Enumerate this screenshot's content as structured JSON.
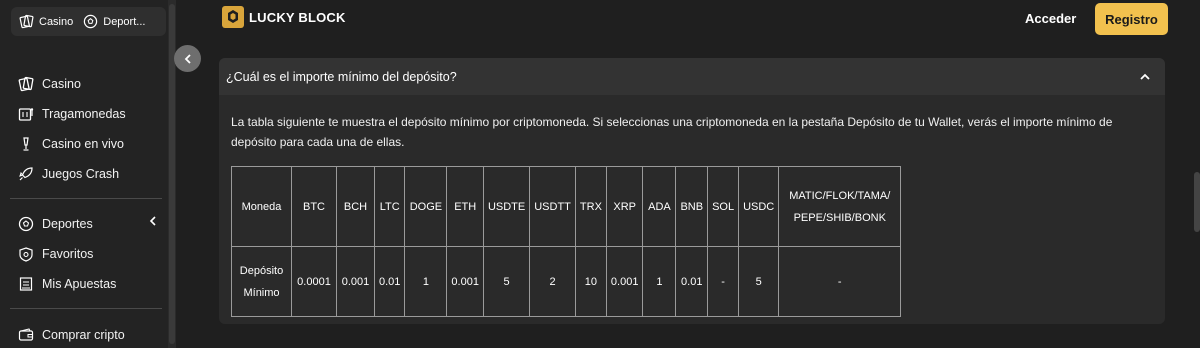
{
  "sidebar": {
    "top_tabs": [
      {
        "label": "Casino",
        "icon": "casino-icon"
      },
      {
        "label": "Deport...",
        "icon": "soccer-ball-icon"
      }
    ],
    "items": [
      {
        "label": "Casino",
        "icon": "casino-icon"
      },
      {
        "label": "Tragamonedas",
        "icon": "slot-machine-icon"
      },
      {
        "label": "Casino en vivo",
        "icon": "live-casino-icon"
      },
      {
        "label": "Juegos Crash",
        "icon": "rocket-icon"
      },
      {
        "label": "Deportes",
        "icon": "soccer-ball-icon"
      },
      {
        "label": "Favoritos",
        "icon": "favorites-icon"
      },
      {
        "label": "Mis Apuestas",
        "icon": "bets-icon"
      },
      {
        "label": "Comprar cripto",
        "icon": "wallet-icon"
      }
    ]
  },
  "header": {
    "logo_text": "LUCKY BLOCK",
    "login_label": "Acceder",
    "register_label": "Registro"
  },
  "faq": {
    "question": "¿Cuál es el importe mínimo del depósito?",
    "answer": "La tabla siguiente te muestra el depósito mínimo por criptomoneda. Si seleccionas una criptomoneda en la pestaña Depósito de tu Wallet, verás el importe mínimo de depósito para cada una de ellas.",
    "table": {
      "header_label": "Moneda",
      "row_label_line1": "Depósito",
      "row_label_line2": "Mínimo",
      "columns": [
        "BTC",
        "BCH",
        "LTC",
        "DOGE",
        "ETH",
        "USDTE",
        "USDTT",
        "TRX",
        "XRP",
        "ADA",
        "BNB",
        "SOL",
        "USDC"
      ],
      "last_column_line1": "MATIC/FLOK/TAMA/",
      "last_column_line2": "PEPE/SHIB/BONK",
      "values": [
        "0.0001",
        "0.001",
        "0.01",
        "1",
        "0.001",
        "5",
        "2",
        "10",
        "0.001",
        "1",
        "0.01",
        "-",
        "5"
      ],
      "last_value": "-"
    }
  },
  "colors": {
    "accent": "#f2c14e",
    "background": "#1f1f1f",
    "card": "#2a2a2a"
  }
}
